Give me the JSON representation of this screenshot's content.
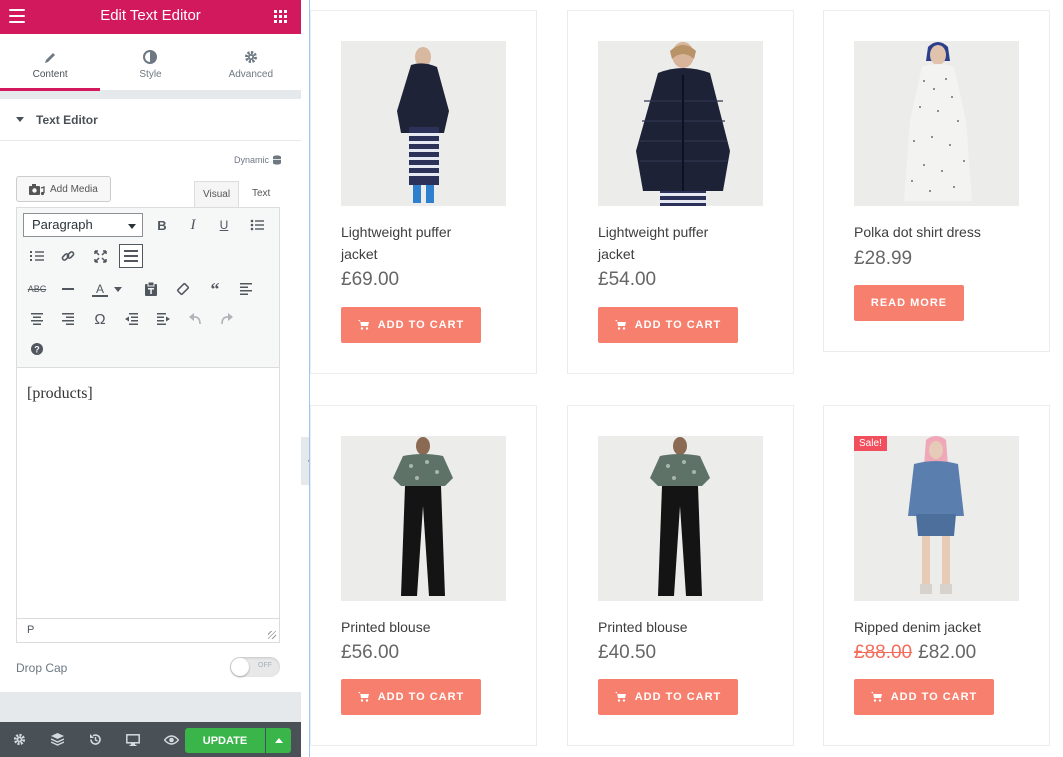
{
  "panel": {
    "title": "Edit Text Editor",
    "tabs": [
      {
        "label": "Content",
        "icon": "pencil-icon"
      },
      {
        "label": "Style",
        "icon": "half-circle-icon"
      },
      {
        "label": "Advanced",
        "icon": "gear-icon"
      }
    ],
    "section_label": "Text Editor",
    "dynamic_label": "Dynamic",
    "add_media_label": "Add Media",
    "editor_tabs": {
      "visual": "Visual",
      "text": "Text"
    },
    "format_select": "Paragraph",
    "content": "[products]",
    "status_path": "P",
    "drop_cap_label": "Drop Cap",
    "drop_cap_state": "OFF",
    "update_label": "UPDATE"
  },
  "products": [
    {
      "name": "Lightweight puffer jacket",
      "price": "£69.00",
      "button": "ADD TO CART",
      "sale": false
    },
    {
      "name": "Lightweight puffer jacket",
      "price": "£54.00",
      "button": "ADD TO CART",
      "sale": false
    },
    {
      "name": "Polka dot shirt dress",
      "price": "£28.99",
      "button": "READ MORE",
      "sale": false
    },
    {
      "name": "Printed blouse",
      "price": "£56.00",
      "button": "ADD TO CART",
      "sale": false
    },
    {
      "name": "Printed blouse",
      "price": "£40.50",
      "button": "ADD TO CART",
      "sale": false
    },
    {
      "name": "Ripped denim jacket",
      "old_price": "£88.00",
      "price": "£82.00",
      "button": "ADD TO CART",
      "sale": true,
      "sale_label": "Sale!"
    }
  ],
  "colors": {
    "brand": "#d3195e",
    "button": "#f77f6e",
    "update": "#39b54a",
    "footer": "#495157"
  }
}
